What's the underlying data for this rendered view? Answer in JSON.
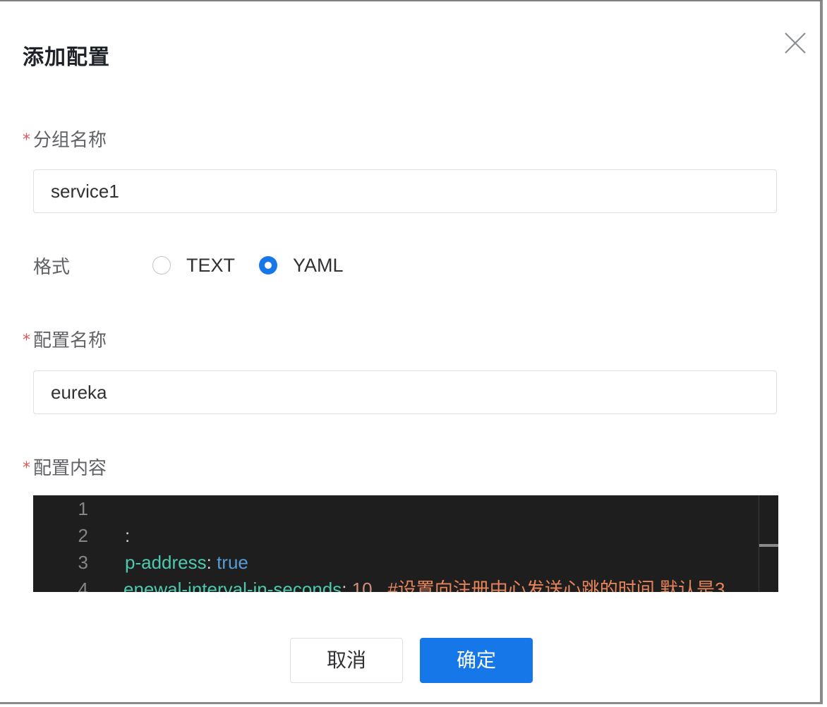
{
  "dialog": {
    "title": "添加配置",
    "close_icon": "close-icon"
  },
  "form": {
    "group": {
      "required_mark": "*",
      "label": "分组名称",
      "value": "service1"
    },
    "format": {
      "label": "格式",
      "options": [
        {
          "label": "TEXT",
          "checked": false
        },
        {
          "label": "YAML",
          "checked": true
        }
      ]
    },
    "config_name": {
      "required_mark": "*",
      "label": "配置名称",
      "value": "eureka"
    },
    "content": {
      "required_mark": "*",
      "label": "配置内容",
      "lines": [
        {
          "num": "1",
          "key": "",
          "sep": "",
          "val": "",
          "comment": ""
        },
        {
          "num": "2",
          "key": "",
          "sep": ":",
          "val": "",
          "comment": ""
        },
        {
          "num": "3",
          "key": "p-address",
          "sep": ": ",
          "val": "true",
          "comment": ""
        },
        {
          "num": "4",
          "key": "enewal-interval-in-seconds",
          "sep": ": ",
          "val": "10",
          "comment": "#设置向注册中心发送心跳的时间,默认是3"
        }
      ]
    }
  },
  "buttons": {
    "cancel": "取消",
    "confirm": "确定"
  },
  "colors": {
    "primary": "#1677e8",
    "required": "#e05555",
    "editor_bg": "#1e1e1e",
    "yaml_key": "#4ec9b0",
    "yaml_value": "#569cd6",
    "yaml_comment": "#e8845a"
  }
}
